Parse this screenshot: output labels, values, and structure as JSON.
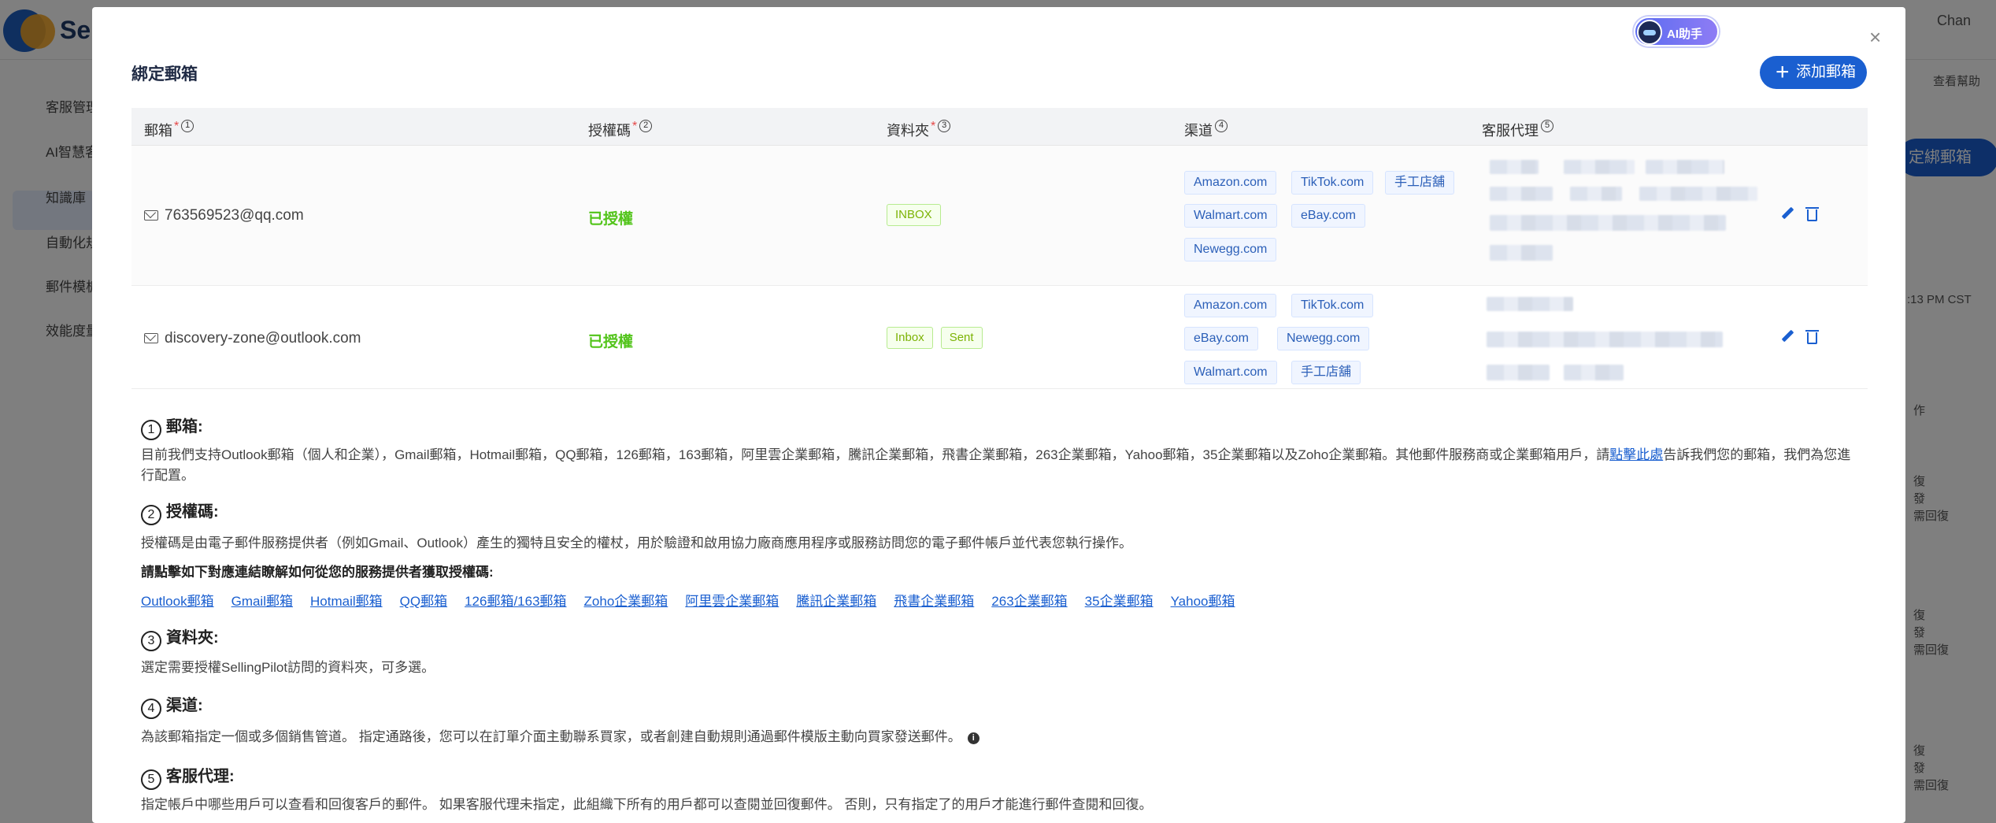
{
  "background": {
    "brand": "Se",
    "user": "Chan",
    "sidebar": [
      "客服管理",
      "AI智慧客",
      "知識庫",
      "自動化規",
      "郵件模板",
      "效能度量"
    ],
    "right_button": "定綁郵箱",
    "right_texts": [
      "查看幫助",
      ":13 PM CST",
      "作",
      "復",
      "發",
      "需回復",
      "復",
      "發",
      "需回復",
      "復",
      "發",
      "需回復"
    ]
  },
  "modal": {
    "ai_label": "AI助手",
    "close": "×",
    "title": "綁定郵箱",
    "add_button": "添加郵箱"
  },
  "table": {
    "headers": [
      {
        "label": "郵箱",
        "required": true,
        "num": "1"
      },
      {
        "label": "授權碼",
        "required": true,
        "num": "2"
      },
      {
        "label": "資料夾",
        "required": true,
        "num": "3"
      },
      {
        "label": "渠道",
        "required": false,
        "num": "4"
      },
      {
        "label": "客服代理",
        "required": false,
        "num": "5"
      }
    ],
    "rows": [
      {
        "email": "763569523@qq.com",
        "auth": "已授權",
        "folders": [
          "INBOX"
        ],
        "channels": [
          "Amazon.com",
          "TikTok.com",
          "手工店舖",
          "Walmart.com",
          "eBay.com",
          "Newegg.com"
        ]
      },
      {
        "email": "discovery-zone@outlook.com",
        "auth": "已授權",
        "folders": [
          "Inbox",
          "Sent"
        ],
        "channels": [
          "Amazon.com",
          "TikTok.com",
          "eBay.com",
          "Newegg.com",
          "Walmart.com",
          "手工店舖"
        ]
      }
    ]
  },
  "notes": {
    "n1": {
      "num": "1",
      "title": "郵箱:",
      "text_before": "目前我們支持Outlook郵箱（個人和企業），Gmail郵箱，Hotmail郵箱，QQ郵箱，126郵箱，163郵箱，阿里雲企業郵箱，騰訊企業郵箱，飛書企業郵箱，263企業郵箱，Yahoo郵箱，35企業郵箱以及Zoho企業郵箱。其他郵件服務商或企業郵箱用戶，請",
      "link": "點擊此處",
      "text_after": "告訴我們您的郵箱，我們為您進行配置。"
    },
    "n2": {
      "num": "2",
      "title": "授權碼:",
      "text": "授權碼是由電子郵件服務提供者（例如Gmail、Outlook）產生的獨特且安全的權杖，用於驗證和啟用協力廠商應用程序或服務訪問您的電子郵件帳戶並代表您執行操作。",
      "bold": "請點擊如下對應連結瞭解如何從您的服務提供者獲取授權碼:",
      "links": [
        "Outlook郵箱",
        "Gmail郵箱",
        "Hotmail郵箱",
        "QQ郵箱",
        "126郵箱/163郵箱",
        "Zoho企業郵箱",
        "阿里雲企業郵箱",
        "騰訊企業郵箱",
        "飛書企業郵箱",
        "263企業郵箱",
        "35企業郵箱",
        "Yahoo郵箱"
      ]
    },
    "n3": {
      "num": "3",
      "title": "資料夾:",
      "text": "選定需要授權SellingPilot訪問的資料夾，可多選。"
    },
    "n4": {
      "num": "4",
      "title": "渠道:",
      "text": "為該郵箱指定一個或多個銷售管道。 指定通路後，您可以在訂單介面主動聯系買家，或者創建自動規則通過郵件模版主動向買家發送郵件。"
    },
    "n5": {
      "num": "5",
      "title": "客服代理:",
      "text": "指定帳戶中哪些用戶可以查看和回復客戶的郵件。 如果客服代理未指定，此組織下所有的用戶都可以查閱並回復郵件。 否則，只有指定了的用戶才能進行郵件查閱和回復。"
    }
  }
}
